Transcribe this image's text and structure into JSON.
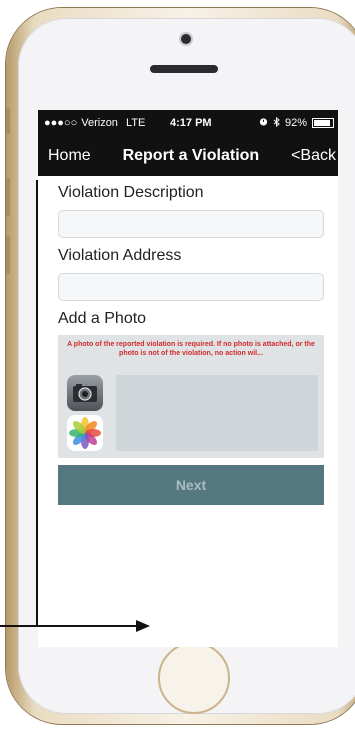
{
  "status_bar": {
    "signal": "●●●○○",
    "carrier": "Verizon",
    "network": "LTE",
    "time": "4:17 PM",
    "alarm_icon": "alarm-clock-icon",
    "bluetooth_icon": "bluetooth-icon",
    "battery": "92%"
  },
  "nav": {
    "home_label": "Home",
    "title": "Report a Violation",
    "back_label": "<Back"
  },
  "form": {
    "description_label": "Violation Description",
    "description_value": "",
    "address_label": "Violation Address",
    "address_value": "",
    "photo_label": "Add a Photo",
    "photo_note": "A photo of the reported violation is required. If no photo is attached, or the photo is not of the violation, no action wil...",
    "camera_icon": "camera-icon",
    "gallery_icon": "photos-icon",
    "next_label": "Next"
  },
  "colors": {
    "nav_bg": "#111111",
    "note_red": "#d22b2b",
    "next_bg": "#55777f",
    "panel_bg": "#dfe3e5"
  }
}
